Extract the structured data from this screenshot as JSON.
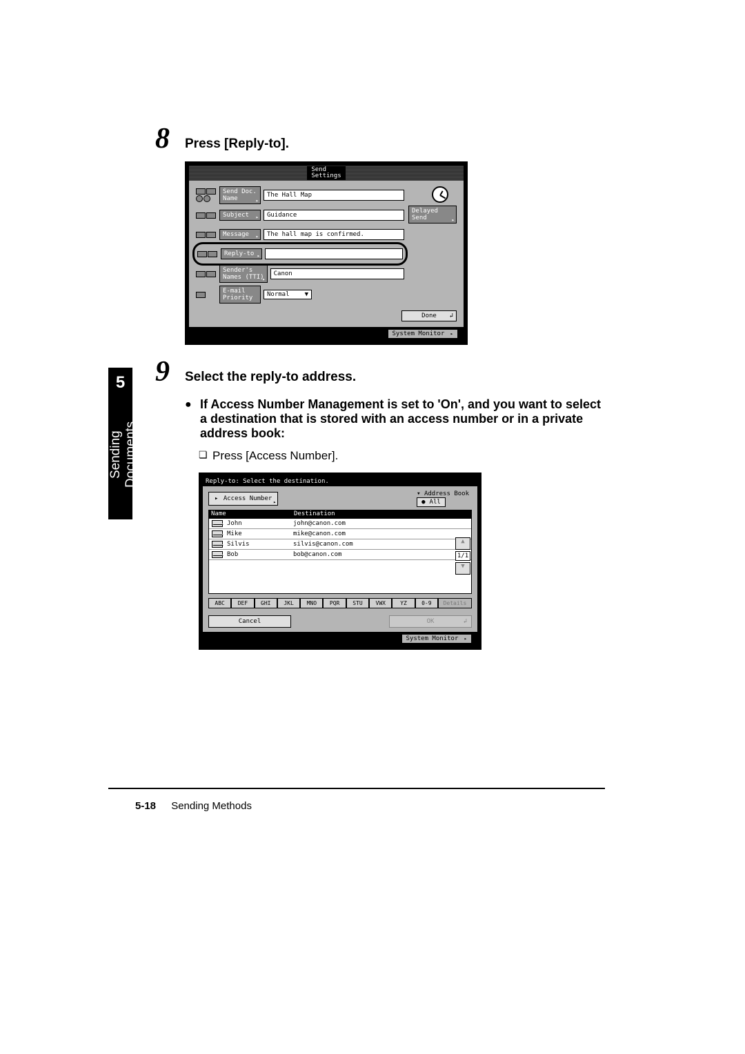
{
  "step8": {
    "num": "8",
    "heading": "Press [Reply-to]."
  },
  "panel1": {
    "title_top": "Send",
    "title_bottom": "Settings",
    "rows": {
      "send_doc_label_1": "Send Doc.",
      "send_doc_label_2": "Name",
      "send_doc_value": "The Hall Map",
      "subject_label": "Subject",
      "subject_value": "Guidance",
      "message_label": "Message",
      "message_value": "The hall map is confirmed.",
      "reply_to_label": "Reply-to",
      "senders_label_1": "Sender's",
      "senders_label_2": "Names (TTI)",
      "senders_value": "Canon",
      "priority_label_1": "E-mail",
      "priority_label_2": "Priority",
      "priority_value": "Normal",
      "delayed_label_1": "Delayed",
      "delayed_label_2": "Send"
    },
    "done": "Done",
    "sysmon": "System Monitor"
  },
  "step9": {
    "num": "9",
    "heading": "Select the reply-to address.",
    "sub": "If Access Number Management is set to 'On', and you want to select a destination that is stored with an access number or in a private address book:",
    "body": "Press [Access Number]."
  },
  "panel2": {
    "title": "Reply-to: Select the destination.",
    "access_number": "Access Number",
    "addr_book_label": "Address Book",
    "addr_book_value": "All",
    "col_name": "Name",
    "col_dest": "Destination",
    "rows": [
      {
        "name": "John",
        "dest": "john@canon.com"
      },
      {
        "name": "Mike",
        "dest": "mike@canon.com"
      },
      {
        "name": "Silvis",
        "dest": "silvis@canon.com"
      },
      {
        "name": "Bob",
        "dest": "bob@canon.com"
      }
    ],
    "pager": "1/1",
    "letters": [
      "ABC",
      "DEF",
      "GHI",
      "JKL",
      "MNO",
      "PQR",
      "STU",
      "VWX",
      "YZ",
      "0-9"
    ],
    "details": "Details",
    "cancel": "Cancel",
    "ok": "OK",
    "sysmon": "System Monitor"
  },
  "sidebar": {
    "chapter": "5",
    "label": "Sending Documents"
  },
  "footer": {
    "page": "5-18",
    "title": "Sending Methods"
  }
}
